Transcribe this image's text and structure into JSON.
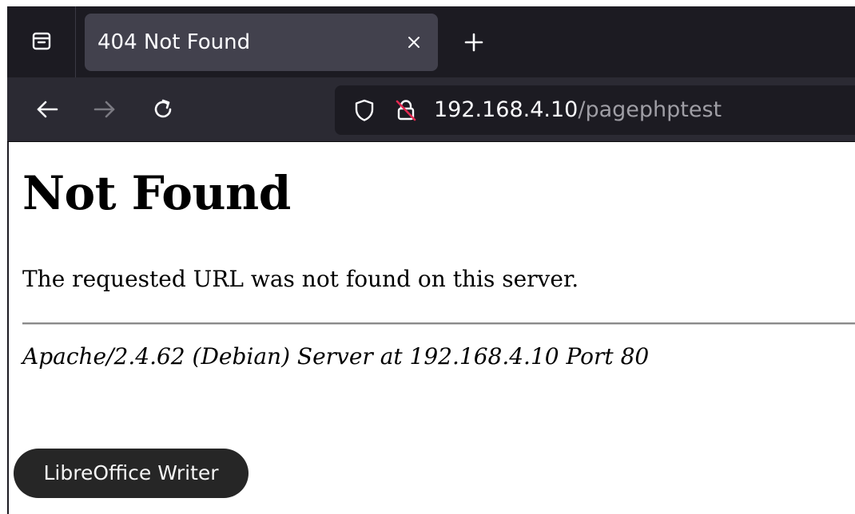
{
  "tabbar": {
    "tab_title": "404 Not Found",
    "icons": {
      "overview": "tab-overview-icon",
      "close": "close-icon",
      "new_tab": "plus-icon"
    }
  },
  "navbar": {
    "icons": {
      "back": "back-arrow-icon",
      "forward": "forward-arrow-icon",
      "reload": "reload-icon",
      "tracking": "shield-icon",
      "insecure": "insecure-lock-icon"
    },
    "url_host": "192.168.4.10",
    "url_path": "/pagephptest"
  },
  "page": {
    "heading": "Not Found",
    "message": "The requested URL was not found on this server.",
    "server_signature": "Apache/2.4.62 (Debian) Server at 192.168.4.10 Port 80"
  },
  "tooltip": {
    "label": "LibreOffice Writer"
  },
  "colors": {
    "tabbar_bg": "#1c1b22",
    "tab_active_bg": "#42414d",
    "navbar_bg": "#2b2a33",
    "urlbar_bg": "#1c1b22",
    "insecure_accent": "#e22850"
  }
}
